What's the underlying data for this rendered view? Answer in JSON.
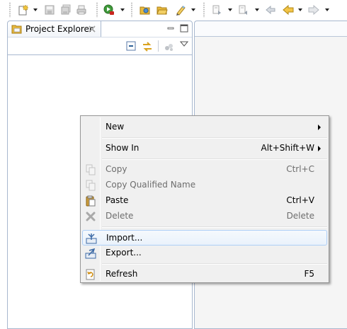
{
  "toolbar": {
    "buttons": [
      {
        "name": "new-wizard-icon"
      },
      {
        "name": "save-icon"
      },
      {
        "name": "save-all-icon"
      },
      {
        "name": "print-icon"
      },
      {
        "name": "run-icon"
      },
      {
        "name": "open-type-icon"
      },
      {
        "name": "open-folder-icon"
      },
      {
        "name": "search-pencil-icon"
      },
      {
        "name": "next-annotation-icon"
      },
      {
        "name": "prev-annotation-icon"
      },
      {
        "name": "last-edit-location-icon"
      },
      {
        "name": "back-icon"
      },
      {
        "name": "forward-icon"
      }
    ]
  },
  "explorer": {
    "tab_title": "Project Explorer"
  },
  "context_menu": {
    "items": [
      {
        "label": "New",
        "accel": "",
        "submenu": true,
        "enabled": true,
        "icon": ""
      },
      {
        "label": "Show In",
        "accel": "Alt+Shift+W",
        "submenu": true,
        "enabled": true,
        "icon": ""
      },
      {
        "label": "Copy",
        "accel": "Ctrl+C",
        "submenu": false,
        "enabled": false,
        "icon": "copy-icon"
      },
      {
        "label": "Copy Qualified Name",
        "accel": "",
        "submenu": false,
        "enabled": false,
        "icon": "copy-qualified-name-icon"
      },
      {
        "label": "Paste",
        "accel": "Ctrl+V",
        "submenu": false,
        "enabled": true,
        "icon": "paste-icon"
      },
      {
        "label": "Delete",
        "accel": "Delete",
        "submenu": false,
        "enabled": false,
        "icon": "delete-icon"
      },
      {
        "label": "Import...",
        "accel": "",
        "submenu": false,
        "enabled": true,
        "highlighted": true,
        "icon": "import-icon"
      },
      {
        "label": "Export...",
        "accel": "",
        "submenu": false,
        "enabled": true,
        "icon": "export-icon"
      },
      {
        "label": "Refresh",
        "accel": "F5",
        "submenu": false,
        "enabled": true,
        "icon": "refresh-icon"
      }
    ]
  },
  "colors": {
    "menu_bg": "#f0f0f0",
    "highlight_border": "#aecff7",
    "view_border": "#a8b8cf",
    "disabled_text": "#6d6d6d"
  }
}
